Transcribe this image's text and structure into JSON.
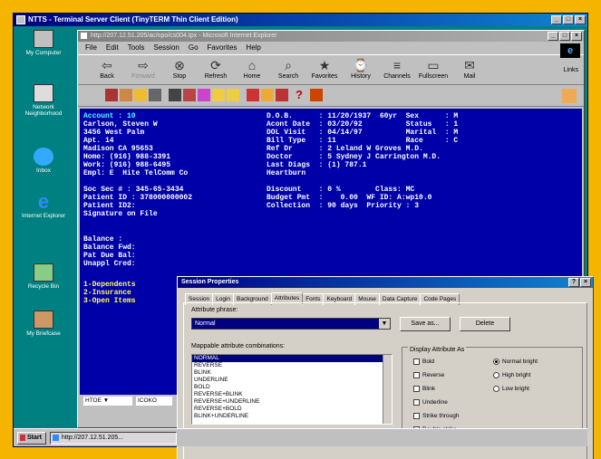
{
  "window": {
    "title": "NTTS - Terminal Server Client (TinyTERM Thin Client Edition)"
  },
  "desktop_icons": [
    {
      "label": "My Computer"
    },
    {
      "label": "Network Neighborhood"
    },
    {
      "label": "Inbox"
    },
    {
      "label": "Internet Explorer"
    },
    {
      "label": "Recycle Bin"
    },
    {
      "label": "My Briefcase"
    }
  ],
  "browser": {
    "title": "http://207.12.51.205/ac/npo/cs004.tpx - Microsoft Internet Explorer",
    "menu": [
      "File",
      "Edit",
      "Tools",
      "Session",
      "Go",
      "Favorites",
      "Help"
    ],
    "toolbar": [
      {
        "label": "Back",
        "icon": "back-arrow-icon",
        "disabled": false
      },
      {
        "label": "Forward",
        "icon": "forward-arrow-icon",
        "disabled": true
      },
      {
        "label": "Stop",
        "icon": "stop-icon",
        "disabled": false
      },
      {
        "label": "Refresh",
        "icon": "refresh-icon",
        "disabled": false
      },
      {
        "label": "Home",
        "icon": "home-icon",
        "disabled": false
      },
      {
        "label": "Search",
        "icon": "search-icon",
        "disabled": false
      },
      {
        "label": "Favorites",
        "icon": "favorites-icon",
        "disabled": false
      },
      {
        "label": "History",
        "icon": "history-icon",
        "disabled": false
      },
      {
        "label": "Channels",
        "icon": "channels-icon",
        "disabled": false
      },
      {
        "label": "Fullscreen",
        "icon": "fullscreen-icon",
        "disabled": false
      },
      {
        "label": "Mail",
        "icon": "mail-icon",
        "disabled": false
      }
    ],
    "links_label": "Links"
  },
  "terminal": {
    "left": [
      "Account : 10",
      "Carlson, Steven W",
      "3456 West Palm",
      "Apt. 14",
      "Madison CA 95653",
      "Home: (916) 988-3391",
      "Work: (916) 988-6495",
      "Empl: E  Hite TelComm Co",
      "",
      "Soc Sec # : 345-65-3434",
      "Patient ID : 378000000002",
      "Patient ID2:",
      "Signature on File"
    ],
    "right": [
      "D.O.B.      : 11/20/1937  60yr  Sex      : M",
      "Acont Date  : 03/20/92          Status   : 1",
      "DOL Visit   : 04/14/97          Marital  : M",
      "Bill Type   : 11                Race     : C",
      "Ref Dr      : 2 Leland W Groves M.D.",
      "Doctor      : 5 Sydney J Carrington M.D.",
      "Last Diags  : (1) 787.1",
      "Heartburn",
      "",
      "Discount    : 0 %        Class: MC",
      "Budget Pmt  :    0.00  WF ID: A:wp10.0",
      "Collection  : 90 days  Priority : 3"
    ],
    "balances": [
      "Balance :",
      "Balance Fwd:",
      "Pat Due Bal:",
      "Unappl Cred:"
    ],
    "menu": [
      "1-Dependents",
      "2-Insurance",
      "3-Open Items"
    ],
    "status_select": "HTOE",
    "status_field": "ICOKO"
  },
  "dialog": {
    "title": "Session Properties",
    "tabs": [
      "Session",
      "Login",
      "Background",
      "Attributes",
      "Fonts",
      "Keyboard",
      "Mouse",
      "Data Capture",
      "Code Pages"
    ],
    "active_tab": "Attributes",
    "attribute_phrase_label": "Attribute phrase:",
    "attribute_phrase_value": "Normal",
    "save_as": "Save as...",
    "delete": "Delete",
    "mappable_label": "Mappable attribute combinations:",
    "combinations": [
      "NORMAL",
      "REVERSE",
      "BLINK",
      "UNDERLINE",
      "BOLD",
      "REVERSE+BLINK",
      "REVERSE+UNDERLINE",
      "REVERSE+BOLD",
      "BLINK+UNDERLINE"
    ],
    "display_as_label": "Display Attribute As",
    "checks": [
      "Bold",
      "Reverse",
      "Blink",
      "Underline",
      "Strike through",
      "Double strike"
    ],
    "radios": [
      "Normal bright",
      "High bright",
      "Low bright"
    ],
    "selected_radio": "Normal bright"
  },
  "taskbar": {
    "start": "Start",
    "item": "http://207.12.51.205..."
  }
}
